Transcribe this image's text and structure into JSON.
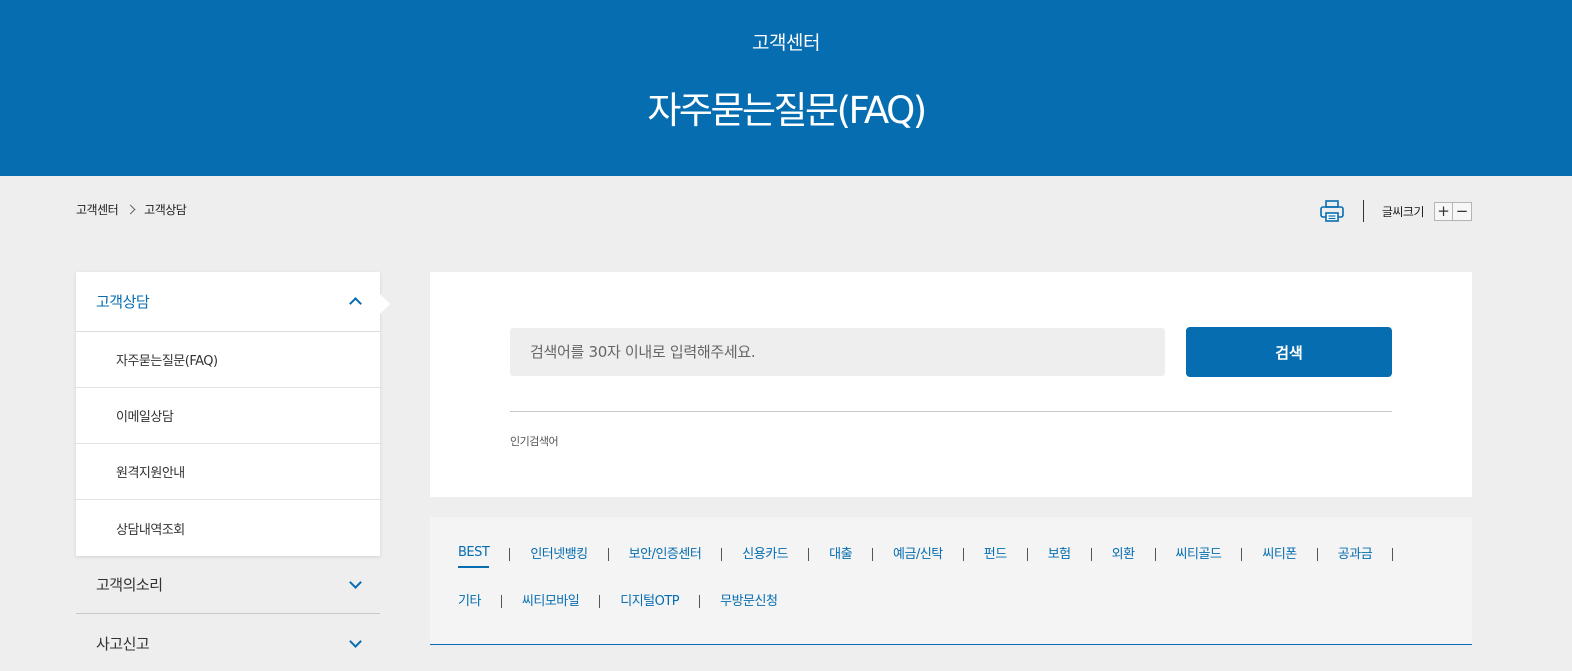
{
  "hero": {
    "subtitle": "고객센터",
    "title": "자주묻는질문(FAQ)"
  },
  "breadcrumb": [
    "고객센터",
    "고객상담"
  ],
  "tools": {
    "font_size_label": "글씨크기",
    "plus": "+",
    "minus": "−"
  },
  "lnb": {
    "active_group": "고객상담",
    "sub_items": [
      "자주묻는질문(FAQ)",
      "이메일상담",
      "원격지원안내",
      "상담내역조회"
    ],
    "groups": [
      "고객의소리",
      "사고신고"
    ]
  },
  "search": {
    "placeholder": "검색어를 30자 이내로 입력해주세요.",
    "button": "검색",
    "popular_label": "인기검색어"
  },
  "tabs": {
    "row1": [
      "BEST",
      "인터넷뱅킹",
      "보안/인증센터",
      "신용카드",
      "대출",
      "예금/신탁",
      "펀드",
      "보험",
      "외환",
      "씨티골드",
      "씨티폰",
      "공과금"
    ],
    "row2": [
      "기타",
      "씨티모바일",
      "디지털OTP",
      "무방문신청"
    ],
    "active": "BEST"
  },
  "colors": {
    "brand": "#066db1",
    "background": "#eeeeee"
  }
}
